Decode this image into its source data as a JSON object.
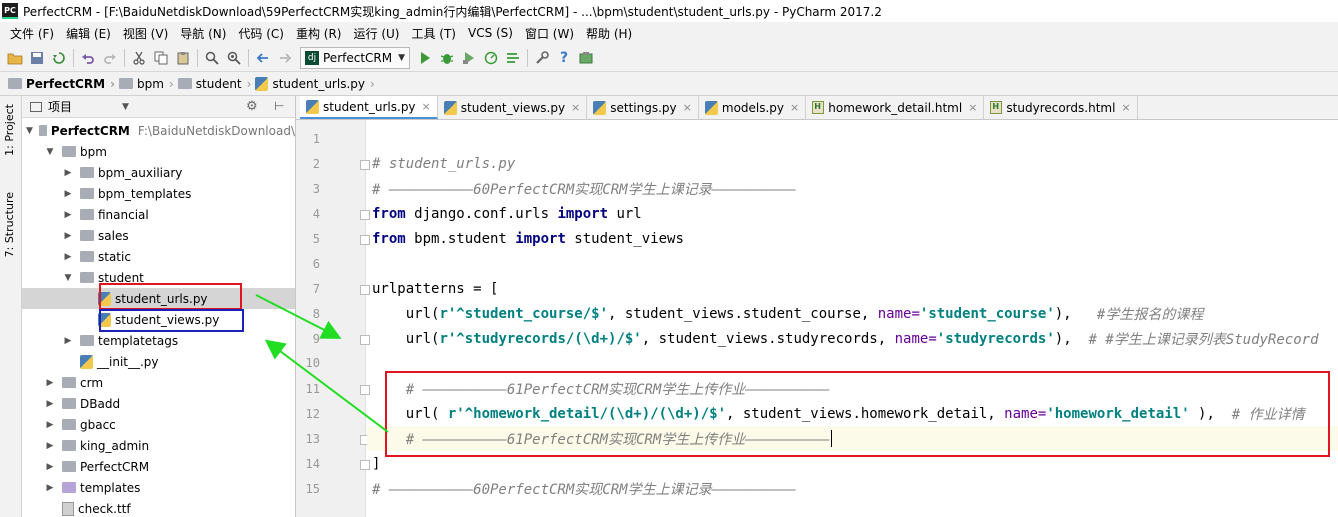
{
  "window": {
    "app_icon": "PC",
    "title": "PerfectCRM - [F:\\BaiduNetdiskDownload\\59PerfectCRM实现king_admin行内编辑\\PerfectCRM] - ...\\bpm\\student\\student_urls.py - PyCharm 2017.2"
  },
  "menu": [
    {
      "label": "文件 (F)"
    },
    {
      "label": "编辑 (E)"
    },
    {
      "label": "视图 (V)"
    },
    {
      "label": "导航 (N)"
    },
    {
      "label": "代码 (C)"
    },
    {
      "label": "重构 (R)"
    },
    {
      "label": "运行 (U)"
    },
    {
      "label": "工具 (T)"
    },
    {
      "label": "VCS (S)"
    },
    {
      "label": "窗口 (W)"
    },
    {
      "label": "帮助 (H)"
    }
  ],
  "toolbar": {
    "run_config": "PerfectCRM",
    "run_config_icon": "dj"
  },
  "breadcrumb": [
    {
      "label": "PerfectCRM"
    },
    {
      "label": "bpm"
    },
    {
      "label": "student"
    },
    {
      "label": "student_urls.py"
    }
  ],
  "toolstrip": {
    "project_tab": "1: Project",
    "structure_tab": "7: Structure"
  },
  "project_panel": {
    "title": "项目",
    "root": {
      "label": "PerfectCRM",
      "path": "F:\\BaiduNetdiskDownload\\"
    },
    "items": [
      {
        "label": "bpm"
      },
      {
        "label": "bpm_auxiliary"
      },
      {
        "label": "bpm_templates"
      },
      {
        "label": "financial"
      },
      {
        "label": "sales"
      },
      {
        "label": "static"
      },
      {
        "label": "student"
      },
      {
        "label": "student_urls.py"
      },
      {
        "label": "student_views.py"
      },
      {
        "label": "templatetags"
      },
      {
        "label": "__init__.py"
      },
      {
        "label": "crm"
      },
      {
        "label": "DBadd"
      },
      {
        "label": "gbacc"
      },
      {
        "label": "king_admin"
      },
      {
        "label": "PerfectCRM"
      },
      {
        "label": "templates"
      },
      {
        "label": "check.ttf"
      }
    ]
  },
  "tabs": [
    {
      "label": "student_urls.py"
    },
    {
      "label": "student_views.py"
    },
    {
      "label": "settings.py"
    },
    {
      "label": "models.py"
    },
    {
      "label": "homework_detail.html"
    },
    {
      "label": "studyrecords.html"
    }
  ],
  "editor": {
    "line_numbers": [
      "1",
      "2",
      "3",
      "4",
      "5",
      "6",
      "7",
      "8",
      "9",
      "10",
      "11",
      "12",
      "13",
      "14",
      "15"
    ],
    "code": {
      "l2": "# student_urls.py",
      "l3": "# ——————————60PerfectCRM实现CRM学生上课记录——————————",
      "l4_kw1": "from",
      "l4_mod": " django.conf.urls ",
      "l4_kw2": "import",
      "l4_name": " url",
      "l5_kw1": "from",
      "l5_mod": " bpm.student ",
      "l5_kw2": "import",
      "l5_name": " student_views",
      "l7": "urlpatterns = [",
      "l8_pre": "    url(",
      "l8_str": "r'^student_course/$'",
      "l8_mid": ", student_views.student_course, ",
      "l8_kw": "name=",
      "l8_name": "'student_course'",
      "l8_post": "),   ",
      "l8_comment": "#学生报名的课程",
      "l9_pre": "    url(",
      "l9_str": "r'^studyrecords/(\\d+)/$'",
      "l9_mid": ", student_views.studyrecords, ",
      "l9_kw": "name=",
      "l9_name": "'studyrecords'",
      "l9_post": "),  ",
      "l9_comment": "# #学生上课记录列表StudyRecord",
      "l11": "    # ——————————61PerfectCRM实现CRM学生上传作业——————————",
      "l12_pre": "    url( ",
      "l12_str": "r'^homework_detail/(\\d+)/(\\d+)/$'",
      "l12_mid": ", student_views.homework_detail, ",
      "l12_kw": "name=",
      "l12_name": "'homework_detail'",
      "l12_post": " ),  ",
      "l12_comment": "# 作业详情",
      "l13": "    # ——————————61PerfectCRM实现CRM学生上传作业——————————",
      "l14": "]",
      "l15": "# ——————————60PerfectCRM实现CRM学生上课记录——————————"
    }
  },
  "colors": {
    "annotation_red": "#e0151f",
    "annotation_blue": "#1a22b8",
    "annotation_arrow": "#22dd22",
    "keyword": "#000080",
    "string": "#008080",
    "comment": "#808080"
  }
}
